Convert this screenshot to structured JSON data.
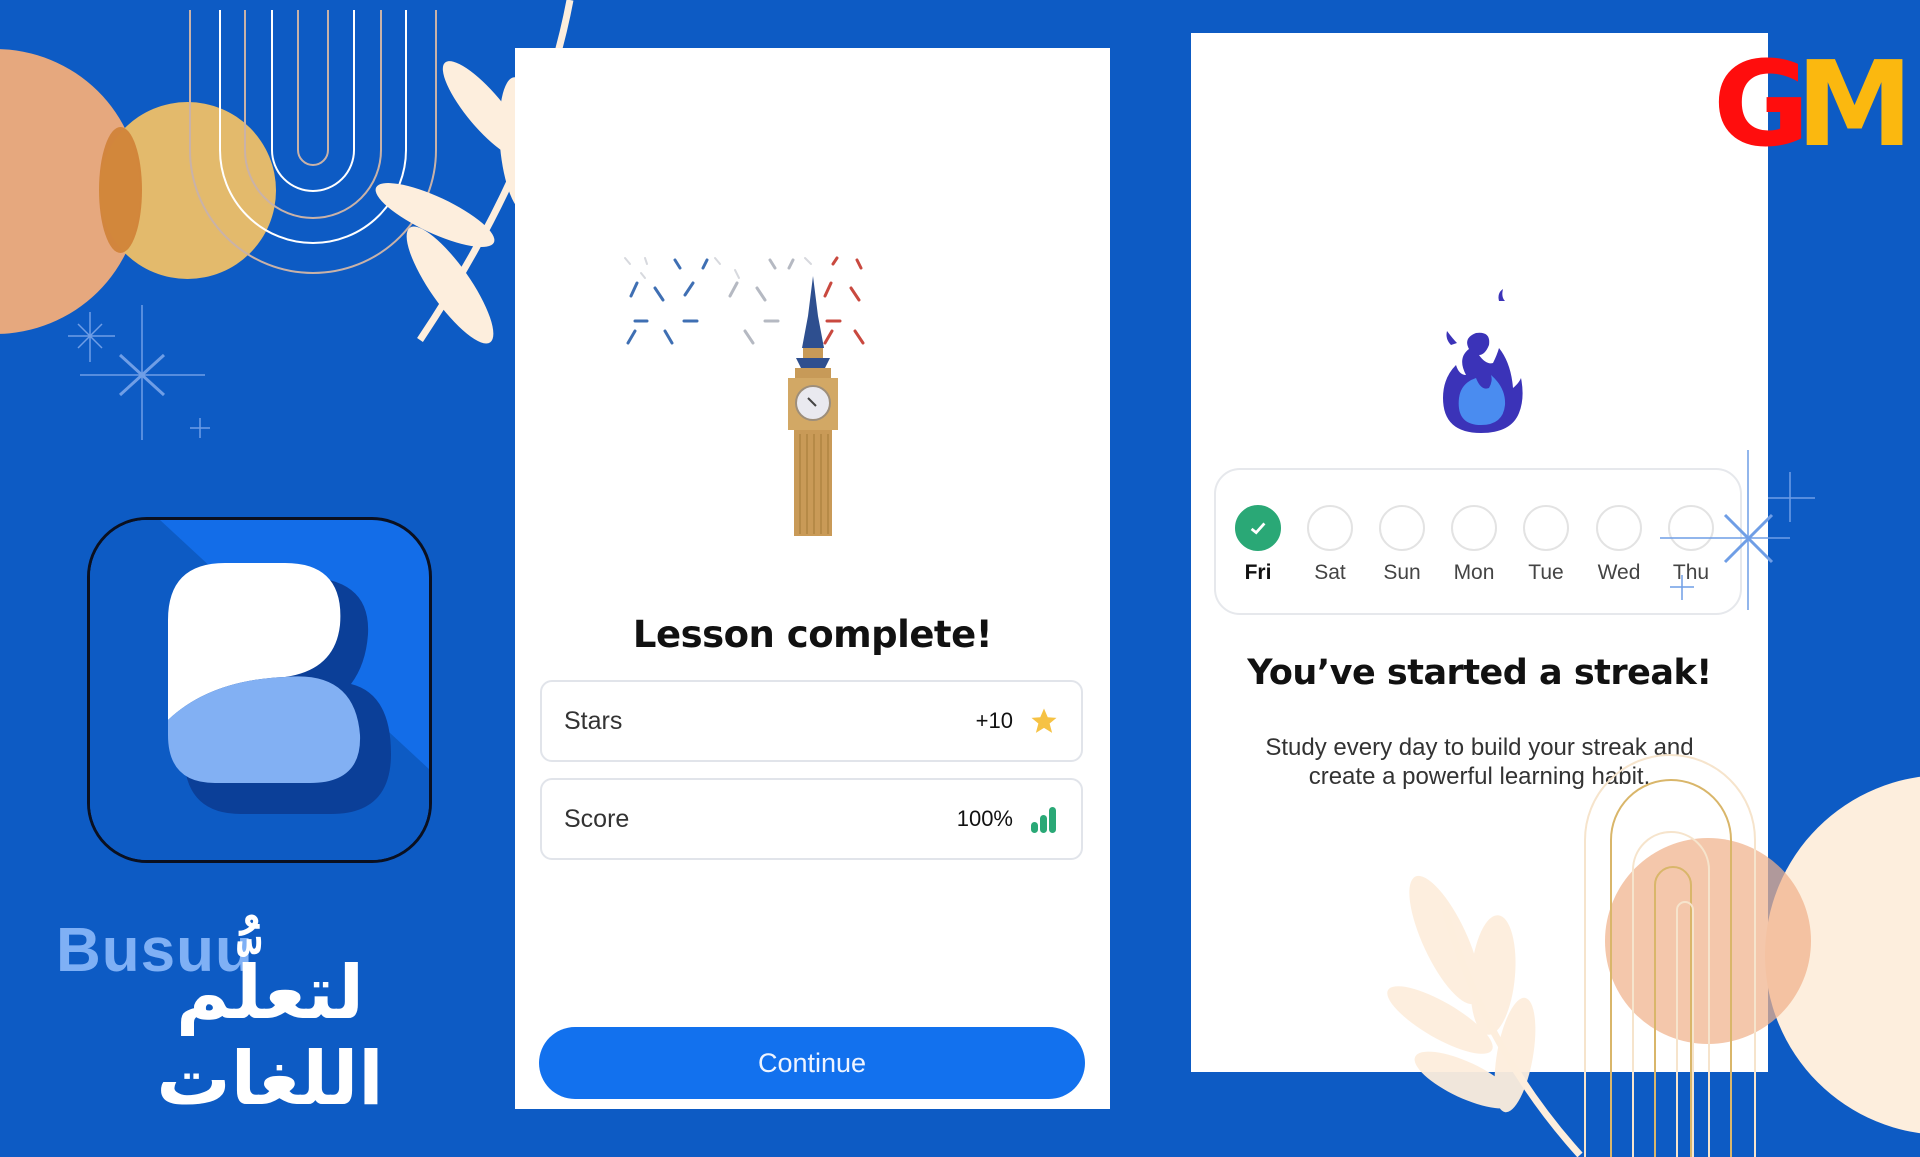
{
  "brand": {
    "app_name": "Busuu",
    "arabic_tagline": "لتعلُّم اللغات",
    "watermark_g": "G",
    "watermark_m": "M",
    "colors": {
      "background": "#0d5bc4",
      "primary_button": "#1271ee",
      "success_green": "#2aa876",
      "star_yellow": "#f6c244",
      "logo_light": "#82b0f3",
      "watermark_red": "#ff0d0d",
      "watermark_yellow": "#fbb80f"
    }
  },
  "lesson_screen": {
    "title": "Lesson complete!",
    "stats": [
      {
        "label": "Stars",
        "value": "+10",
        "icon": "star-icon"
      },
      {
        "label": "Score",
        "value": "100%",
        "icon": "signal-bars-icon"
      }
    ],
    "continue_label": "Continue"
  },
  "streak_screen": {
    "days": [
      {
        "label": "Fri",
        "done": true
      },
      {
        "label": "Sat",
        "done": false
      },
      {
        "label": "Sun",
        "done": false
      },
      {
        "label": "Mon",
        "done": false
      },
      {
        "label": "Tue",
        "done": false
      },
      {
        "label": "Wed",
        "done": false
      },
      {
        "label": "Thu",
        "done": false
      }
    ],
    "title": "You’ve started a streak!",
    "description_line1": "Study every day to build your streak and",
    "description_line2": "create a powerful learning habit."
  }
}
